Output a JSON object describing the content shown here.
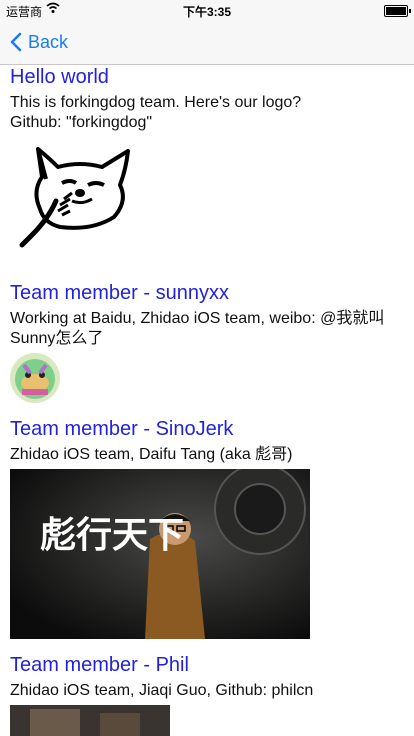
{
  "status": {
    "carrier": "运营商",
    "time": "下午3:35"
  },
  "nav": {
    "back_label": "Back"
  },
  "cells": [
    {
      "title": "Hello world",
      "body": "This is forkingdog team. Here's our logo?\nGithub: \"forkingdog\""
    },
    {
      "title": "Team member - sunnyxx",
      "body": "Working at Baidu, Zhidao iOS team, weibo: @我就叫Sunny怎么了"
    },
    {
      "title": "Team member - SinoJerk",
      "body": "Zhidao iOS team, Daifu Tang (aka 彪哥)",
      "photo_text": "彪行天下"
    },
    {
      "title": "Team member - Phil",
      "body": "Zhidao iOS team, Jiaqi Guo, Github: philcn"
    }
  ],
  "colors": {
    "title": "#2222dd",
    "accent": "#1a7cf2"
  }
}
